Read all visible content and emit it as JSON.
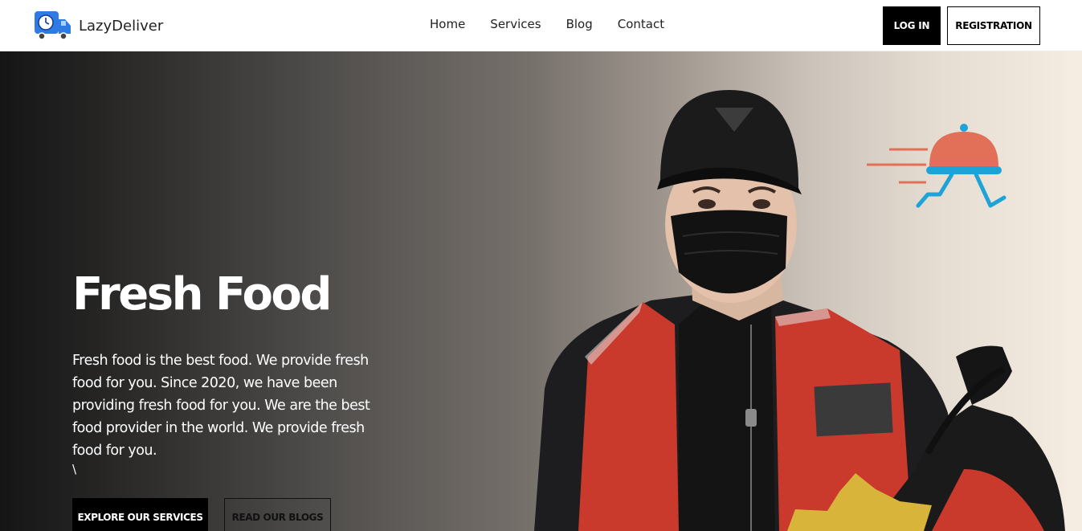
{
  "brand": {
    "name": "LazyDeliver",
    "logo_icon": "delivery-truck-clock-icon"
  },
  "nav": {
    "links": [
      {
        "label": "Home"
      },
      {
        "label": "Services"
      },
      {
        "label": "Blog"
      },
      {
        "label": "Contact"
      }
    ],
    "login_label": "LOG IN",
    "register_label": "REGISTRATION"
  },
  "hero": {
    "title": "Fresh Food",
    "text": "Fresh food is the best food. We provide fresh food for you. Since 2020, we have been providing fresh food for you. We are the best food provider in the world. We provide fresh food for you.",
    "stray_char": "\\",
    "primary_button": "EXPLORE OUR SERVICES",
    "secondary_button": "READ OUR BLOGS",
    "image": "delivery-man-in-mask-with-red-vest-photo",
    "decor_icon": "running-food-cloche-icon"
  },
  "colors": {
    "cloche": "#e27058",
    "runner": "#1ea3d8",
    "vest": "#c9392c",
    "truck": "#2f7be6",
    "badge": "#d9b43a"
  }
}
